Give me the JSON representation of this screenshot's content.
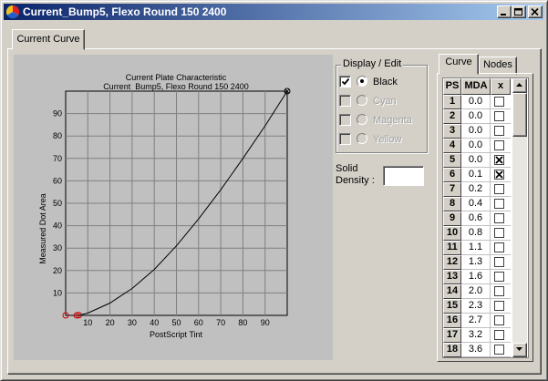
{
  "window": {
    "title": "Current_Bump5, Flexo Round 150 2400",
    "icon": "app-logo-icon",
    "buttons": [
      "minimize-icon",
      "maximize-icon",
      "close-icon"
    ]
  },
  "outer_tab": {
    "label": "Current Curve"
  },
  "display_edit": {
    "legend": "Display / Edit",
    "inks": [
      {
        "label": "Black",
        "checked": true,
        "selected": true,
        "enabled": true
      },
      {
        "label": "Cyan",
        "checked": false,
        "selected": false,
        "enabled": false
      },
      {
        "label": "Magenta",
        "checked": false,
        "selected": false,
        "enabled": false
      },
      {
        "label": "Yellow",
        "checked": false,
        "selected": false,
        "enabled": false
      }
    ]
  },
  "solid_density": {
    "label": "Solid\nDensity :",
    "value": ""
  },
  "right_tabs": {
    "curve": "Curve",
    "nodes": "Nodes"
  },
  "grid": {
    "headers": [
      "PS",
      "MDA",
      "x"
    ],
    "rows": [
      {
        "ps": "1",
        "mda": "0.0",
        "x": false
      },
      {
        "ps": "2",
        "mda": "0.0",
        "x": false
      },
      {
        "ps": "3",
        "mda": "0.0",
        "x": false
      },
      {
        "ps": "4",
        "mda": "0.0",
        "x": false
      },
      {
        "ps": "5",
        "mda": "0.0",
        "x": true
      },
      {
        "ps": "6",
        "mda": "0.1",
        "x": true
      },
      {
        "ps": "7",
        "mda": "0.2",
        "x": false
      },
      {
        "ps": "8",
        "mda": "0.4",
        "x": false
      },
      {
        "ps": "9",
        "mda": "0.6",
        "x": false
      },
      {
        "ps": "10",
        "mda": "0.8",
        "x": false
      },
      {
        "ps": "11",
        "mda": "1.1",
        "x": false
      },
      {
        "ps": "12",
        "mda": "1.3",
        "x": false
      },
      {
        "ps": "13",
        "mda": "1.6",
        "x": false
      },
      {
        "ps": "14",
        "mda": "2.0",
        "x": false
      },
      {
        "ps": "15",
        "mda": "2.3",
        "x": false
      },
      {
        "ps": "16",
        "mda": "2.7",
        "x": false
      },
      {
        "ps": "17",
        "mda": "3.2",
        "x": false
      },
      {
        "ps": "18",
        "mda": "3.6",
        "x": false
      }
    ]
  },
  "colors": {
    "title_start": "#0a246a",
    "title_end": "#a6caf0",
    "face": "#d4d0c8",
    "plot_bg": "#c0c0c0",
    "curve": "#000000",
    "node_marker": "#cc0000"
  },
  "chart_data": {
    "type": "line",
    "title": "Current Plate Characteristic",
    "subtitle": "Current_Bump5, Flexo Round 150 2400",
    "xlabel": "PostScript Tint",
    "ylabel": "Measured Dot Area",
    "xlim": [
      0,
      100
    ],
    "ylim": [
      0,
      100
    ],
    "xticks": [
      10,
      20,
      30,
      40,
      50,
      60,
      70,
      80,
      90
    ],
    "yticks": [
      10,
      20,
      30,
      40,
      50,
      60,
      70,
      80,
      90
    ],
    "grid": true,
    "series": [
      {
        "x": [
          0,
          5,
          6,
          10,
          20,
          30,
          40,
          50,
          60,
          70,
          80,
          90,
          100
        ],
        "y": [
          0,
          0,
          0.1,
          1.0,
          5.5,
          12.0,
          20.5,
          31.0,
          43.0,
          56.0,
          70.0,
          84.5,
          100
        ]
      }
    ],
    "nodes": [
      {
        "x": 0,
        "y": 0
      },
      {
        "x": 5,
        "y": 0
      },
      {
        "x": 6,
        "y": 0.1
      },
      {
        "x": 100,
        "y": 100
      }
    ]
  }
}
